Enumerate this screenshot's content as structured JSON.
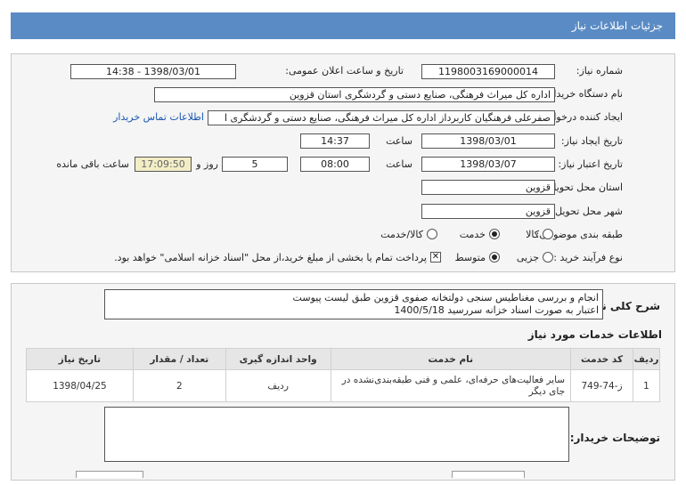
{
  "header": {
    "title": "جزئیات اطلاعات نیاز"
  },
  "form": {
    "need_number": {
      "label": "شماره نیاز:",
      "value": "1198003169000014"
    },
    "announce": {
      "label": "تاریخ و ساعت اعلان عمومی:",
      "value": "1398/03/01 - 14:38"
    },
    "buyer": {
      "label": "نام دستگاه خریدار:",
      "value": "اداره کل میراث فرهنگی، صنایع دستی و گردشگری استان قزوین"
    },
    "requester": {
      "label": "ایجاد کننده درخواست:",
      "value": "صفرعلی فرهنگیان کاربرداز اداره کل میراث فرهنگی، صنایع دستی و گردشگری ا",
      "contact_link": "اطلاعات تماس خریدار"
    },
    "created": {
      "label": "تاریخ ایجاد نیاز:",
      "date": "1398/03/01",
      "time_label": "ساعت",
      "time": "14:37"
    },
    "validity": {
      "label": "تاریخ اعتبار نیاز:",
      "date": "1398/03/07",
      "time_label": "ساعت",
      "time": "08:00",
      "days": "5",
      "days_label": "روز و",
      "remaining": "17:09:50",
      "remaining_label": "ساعت باقی مانده"
    },
    "province": {
      "label": "استان محل تحویل:",
      "value": "قزوین"
    },
    "city": {
      "label": "شهر محل تحویل:",
      "value": "قزوین"
    },
    "category": {
      "label": "طبقه بندی موضوعی:",
      "options": [
        "کالا",
        "خدمت",
        "کالا/خدمت"
      ],
      "selected": "خدمت"
    },
    "process": {
      "label": "نوع فرآیند خرید :",
      "options": [
        "جزیی",
        "متوسط"
      ],
      "selected": "متوسط",
      "note": "پرداخت تمام یا بخشی از مبلغ خرید،از محل \"اسناد خزانه اسلامی\" خواهد بود."
    }
  },
  "summary": {
    "label": "شرح کلی نیاز:",
    "line1": "انجام و بررسی مغناطیس سنجی دولتخانه صفوی قزوین طبق لیست پیوست",
    "line2": "اعتبار به صورت اسناد خزانه سررسید 1400/5/18"
  },
  "services": {
    "section_title": "اطلاعات خدمات مورد نیاز",
    "columns": [
      "ردیف",
      "کد خدمت",
      "نام خدمت",
      "واحد اندازه گیری",
      "تعداد / مقدار",
      "تاریخ نیاز"
    ],
    "rows": [
      {
        "row": "1",
        "code": "ز-74-749",
        "name": "سایر فعالیت‌های حرفه‌ای، علمی و فنی طبقه‌بندی‌نشده در جای دیگر",
        "unit": "ردیف",
        "qty": "2",
        "date": "1398/04/25"
      }
    ]
  },
  "buyer_notes": {
    "label": "توضیحات خریدار:",
    "value": ""
  }
}
